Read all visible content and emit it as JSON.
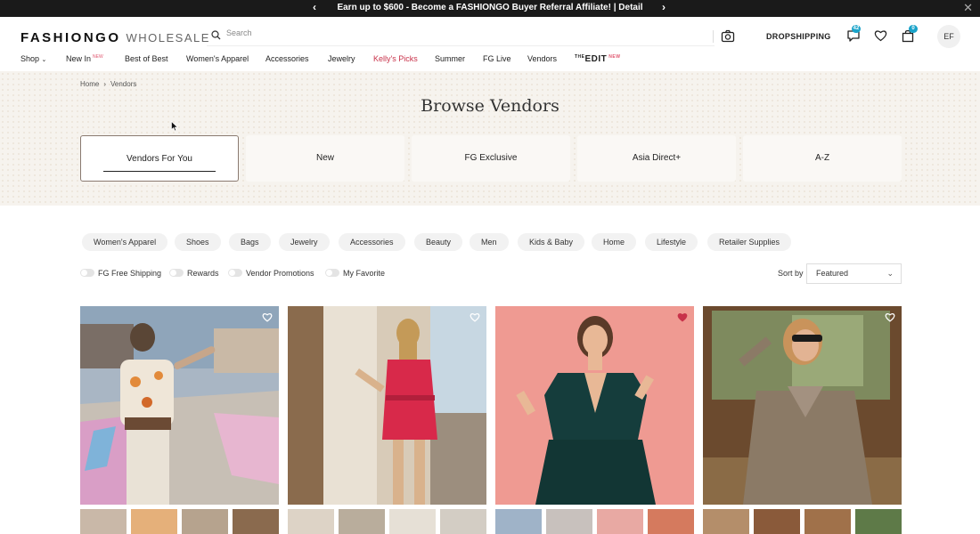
{
  "promo": {
    "message": "Earn up to $600 - Become a FASHIONGO Buyer Referral Affiliate! | Detail"
  },
  "header": {
    "logo_main": "FASHIONGO",
    "logo_sub": "WHOLESALE",
    "search_placeholder": "Search",
    "dropshipping": "DROPSHIPPING",
    "messages_count": "42",
    "cart_count": "0",
    "avatar_initials": "EF"
  },
  "nav": {
    "shop": "Shop",
    "new_in": "New In",
    "new_badge": "NEW",
    "best_of_best": "Best of Best",
    "womens_apparel": "Women's Apparel",
    "accessories": "Accessories",
    "jewelry": "Jewelry",
    "kellys_picks": "Kelly's Picks",
    "summer": "Summer",
    "fg_live": "FG Live",
    "vendors": "Vendors",
    "edit_prefix": "THE",
    "edit_label": "EDIT",
    "edit_badge": "NEW"
  },
  "breadcrumb": {
    "home": "Home",
    "current": "Vendors"
  },
  "page_title": "Browse Vendors",
  "tabs": [
    "Vendors For You",
    "New",
    "FG Exclusive",
    "Asia Direct+",
    "A-Z"
  ],
  "categories": [
    "Women's Apparel",
    "Shoes",
    "Bags",
    "Jewelry",
    "Accessories",
    "Beauty",
    "Men",
    "Kids & Baby",
    "Home",
    "Lifestyle",
    "Retailer Supplies"
  ],
  "filters": [
    "FG Free Shipping",
    "Rewards",
    "Vendor Promotions",
    "My Favorite"
  ],
  "sort": {
    "label": "Sort by",
    "value": "Featured"
  },
  "colors": {
    "accent_red": "#c8324a",
    "badge_blue": "#1aa3c9",
    "hero_bg": "#f6f3ee"
  }
}
